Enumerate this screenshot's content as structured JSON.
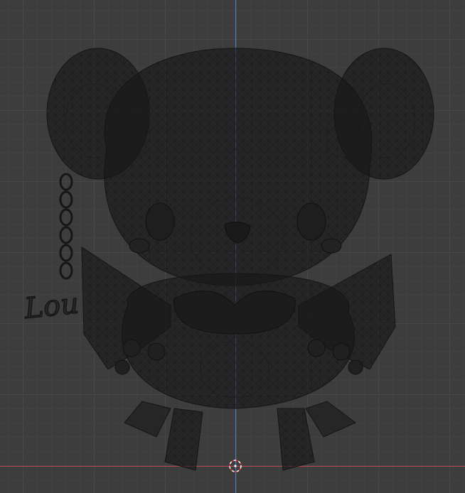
{
  "viewport": {
    "mode": "wireframe",
    "grid_color": "#474747",
    "background_color": "#3d3d3d",
    "axis_y_color": "#4f7fc7",
    "axis_x_color": "#b3464e",
    "wire_color": "#141414"
  },
  "model": {
    "name_text": "Lou",
    "icons": {
      "cursor": "3d-cursor-icon"
    }
  }
}
